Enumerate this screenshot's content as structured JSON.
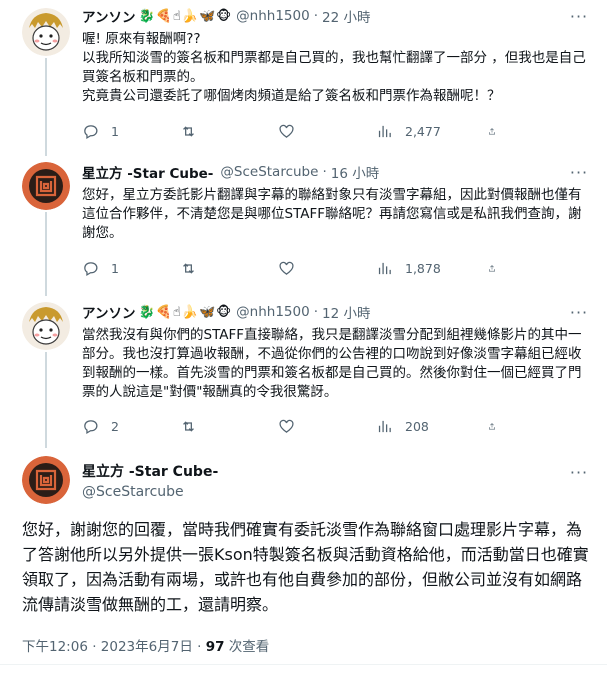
{
  "tweets": [
    {
      "display_name": "アンソン",
      "emojis": [
        "🐉",
        "🍕",
        "☝",
        "🍌",
        "🦋",
        "🐵"
      ],
      "handle": "@nhh1500",
      "separator": "·",
      "time": "22 小時",
      "text": "喔! 原來有報酬啊??\n以我所知淡雪的簽名板和門票都是自己買的，我也幫忙翻譯了一部分 ，但我也是自己買簽名板和門票的。\n究竟貴公司還委託了哪個烤肉頻道是給了簽名板和門票作為報酬呢！？",
      "replies": "1",
      "retweets": "",
      "likes": "",
      "views": "2,477"
    },
    {
      "display_name": "星立方 -Star Cube-",
      "handle": "@SceStarcube",
      "separator": "·",
      "time": "16 小時",
      "text": "您好，星立方委託影片翻譯與字幕的聯絡對象只有淡雪字幕組，因此對價報酬也僅有這位合作夥伴，不清楚您是與哪位STAFF聯絡呢？再請您寫信或是私訊我們查詢，謝謝您。",
      "replies": "1",
      "retweets": "",
      "likes": "",
      "views": "1,878"
    },
    {
      "display_name": "アンソン",
      "emojis": [
        "🐉",
        "🍕",
        "☝",
        "🍌",
        "🦋",
        "🐵"
      ],
      "handle": "@nhh1500",
      "separator": "·",
      "time": "12 小時",
      "text": "當然我沒有與你們的STAFF直接聯絡，我只是翻譯淡雪分配到組裡幾條影片的其中一部分。我也沒打算過收報酬，不過從你們的公告裡的口吻說到好像淡雪字幕組已經收到報酬的一樣。首先淡雪的門票和簽名板都是自己買的。然後你對住一個已經買了門票的人說這是\"對價\"報酬真的令我很驚訝。",
      "replies": "2",
      "retweets": "",
      "likes": "",
      "views": "208"
    }
  ],
  "main_tweet": {
    "display_name": "星立方 -Star Cube-",
    "handle": "@SceStarcube",
    "text": "您好，謝謝您的回覆，當時我們確實有委託淡雪作為聯絡窗口處理影片字幕，為了答謝他所以另外提供一張Kson特製簽名板與活動資格給他，而活動當日也確實領取了，因為活動有兩場，或許也有他自費參加的部份，但敝公司並沒有如網路流傳請淡雪做無酬的工，還請明察。",
    "timestamp": "下午12:06 · 2023年6月7日 · ",
    "views_count": "97",
    "views_label": " 次查看"
  },
  "icons": {
    "more": "more-icon",
    "reply": "reply-icon",
    "retweet": "retweet-icon",
    "like": "like-icon",
    "views": "views-icon",
    "share": "share-icon"
  },
  "colors": {
    "text": "#0f1419",
    "secondary": "#536471",
    "line": "#cfd9de",
    "starcube_orange": "#d9643a",
    "starcube_dark": "#2b1d17"
  }
}
